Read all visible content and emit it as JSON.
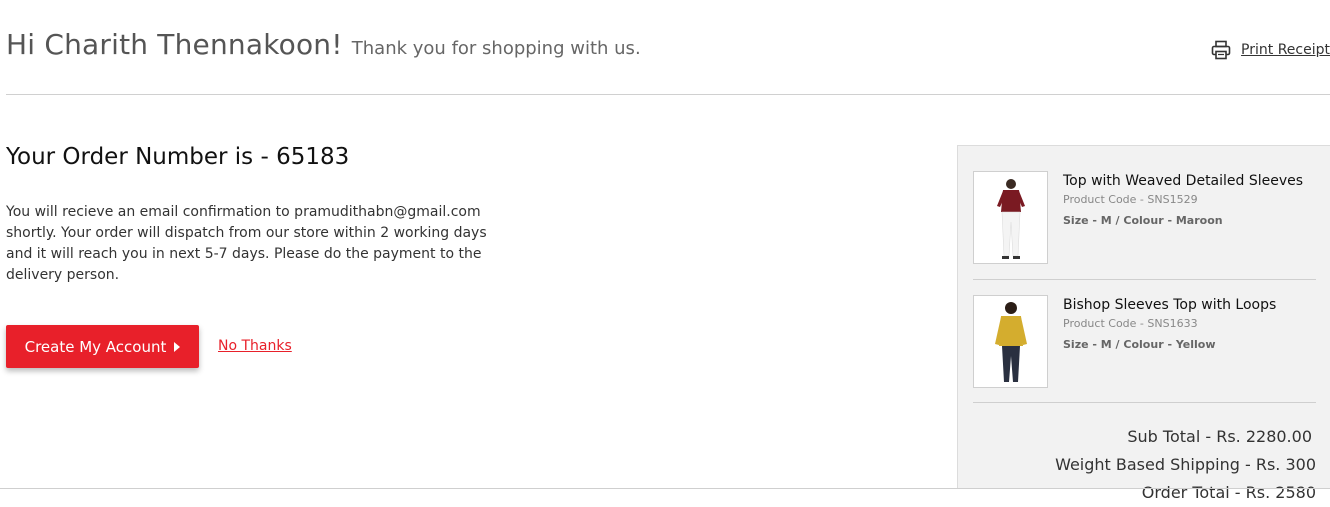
{
  "header": {
    "greeting": "Hi Charith Thennakoon!",
    "thanks": "Thank you for shopping with us.",
    "print_label": "Print Receipt",
    "print_icon": "printer-icon"
  },
  "order": {
    "title": "Your Order Number is - 65183",
    "message": "You will recieve an email confirmation to pramudithabn@gmail.com shortly. Your order will dispatch from our store within 2 working days and it will reach you in next 5-7 days. Please do the payment to the delivery person."
  },
  "actions": {
    "create_account": "Create My Account",
    "no_thanks": "No Thanks"
  },
  "summary": {
    "items": [
      {
        "title": "Top with Weaved Detailed Sleeves",
        "code": "Product Code - SNS1529",
        "attrs": "Size - M / Colour - Maroon",
        "color": "#7a1a22"
      },
      {
        "title": "Bishop Sleeves Top with Loops",
        "code": "Product Code - SNS1633",
        "attrs": "Size - M / Colour - Yellow",
        "color": "#d4ad2e"
      }
    ],
    "sub_total": "Sub Total - Rs. 2280.00",
    "shipping": "Weight Based Shipping - Rs. 300",
    "order_total": "Order Total - Rs. 2580"
  },
  "colors": {
    "accent": "#e8202a",
    "panel_bg": "#f2f2f2"
  }
}
